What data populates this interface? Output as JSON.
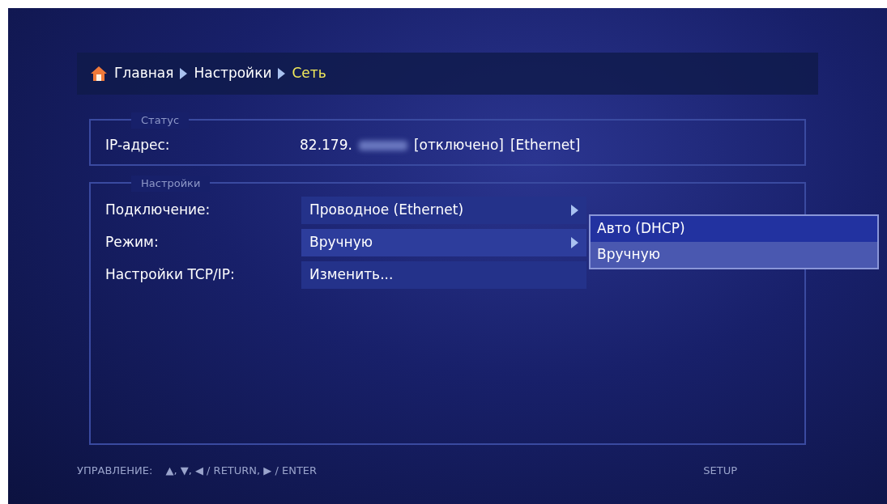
{
  "breadcrumb": [
    {
      "label": "Главная",
      "current": false
    },
    {
      "label": "Настройки",
      "current": false
    },
    {
      "label": "Сеть",
      "current": true
    }
  ],
  "status": {
    "legend": "Статус",
    "label": "IP-адрес:",
    "ip_visible": "82.179.",
    "state": "[отключено]",
    "interface": "[Ethernet]"
  },
  "settings": {
    "legend": "Настройки",
    "rows": [
      {
        "label": "Подключение:",
        "value": "Проводное (Ethernet)",
        "kind": "submenu",
        "expanded": false
      },
      {
        "label": "Режим:",
        "value": "Вручную",
        "kind": "submenu",
        "expanded": true,
        "options": [
          {
            "label": "Авто (DHCP)",
            "selected": false
          },
          {
            "label": "Вручную",
            "selected": true
          }
        ]
      },
      {
        "label": "Настройки TCP/IP:",
        "value": "Изменить...",
        "kind": "action",
        "expanded": false
      }
    ]
  },
  "footer": {
    "label": "УПРАВЛЕНИЕ:",
    "hints": "▲, ▼, ◀ / RETURN, ▶ / ENTER",
    "mode": "SETUP"
  }
}
